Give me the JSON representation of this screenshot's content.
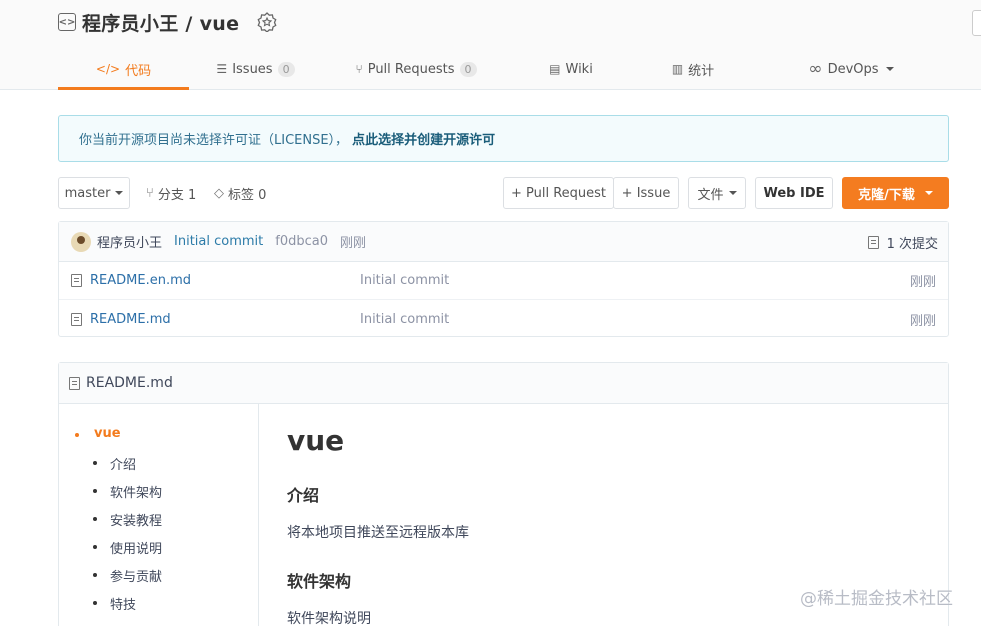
{
  "repo": {
    "title": "程序员小王 / vue",
    "icon": "repo-icon",
    "badge_icon": "award-badge-icon"
  },
  "tabs": [
    {
      "label": "代码",
      "icon": "code-icon",
      "active": true
    },
    {
      "label": "Issues",
      "icon": "issues-icon",
      "count": "0"
    },
    {
      "label": "Pull Requests",
      "icon": "pull-request-icon",
      "count": "0"
    },
    {
      "label": "Wiki",
      "icon": "wiki-icon"
    },
    {
      "label": "统计",
      "icon": "chart-icon"
    },
    {
      "label": "DevOps",
      "icon": "infinity-icon"
    }
  ],
  "license": {
    "text": "你当前开源项目尚未选择许可证（LICENSE），",
    "link": "点此选择并创建开源许可"
  },
  "toolbar": {
    "branch": "master",
    "branches": "分支 1",
    "tags": "标签 0",
    "pull_request": "+ Pull Request",
    "issue": "+ Issue",
    "file": "文件",
    "web_ide": "Web IDE",
    "clone": "克隆/下载"
  },
  "commit": {
    "author": "程序员小王",
    "message": "Initial commit",
    "hash": "f0dbca0",
    "time": "刚刚",
    "count": "1 次提交"
  },
  "files": [
    {
      "name": "README.en.md",
      "commit": "Initial commit",
      "time": "刚刚"
    },
    {
      "name": "README.md",
      "commit": "Initial commit",
      "time": "刚刚"
    }
  ],
  "readme": {
    "header": "README.md",
    "toc": [
      "vue",
      "介绍",
      "软件架构",
      "安装教程",
      "使用说明",
      "参与贡献",
      "特技"
    ],
    "h1": "vue",
    "intro_title": "介绍",
    "intro_text": "将本地项目推送至远程版本库",
    "arch_title": "软件架构",
    "arch_text": "软件架构说明"
  },
  "watermark": "@稀土掘金技术社区",
  "colors": {
    "accent": "#f37b1d",
    "link": "#2c6fa8",
    "notice_bg": "#f3fbfd"
  }
}
